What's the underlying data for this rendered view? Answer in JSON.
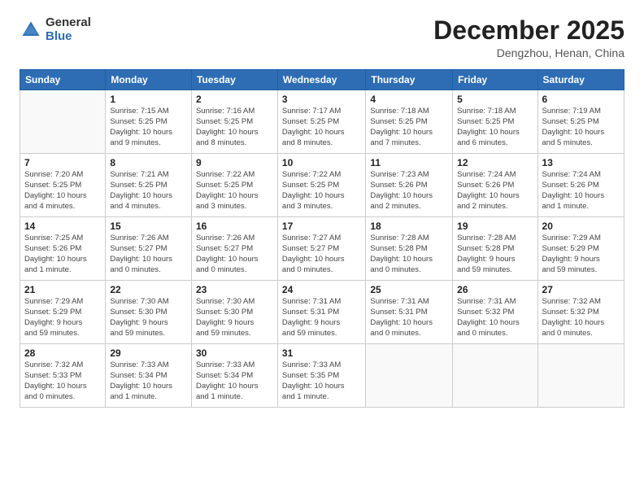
{
  "logo": {
    "general": "General",
    "blue": "Blue"
  },
  "header": {
    "month": "December 2025",
    "location": "Dengzhou, Henan, China"
  },
  "weekdays": [
    "Sunday",
    "Monday",
    "Tuesday",
    "Wednesday",
    "Thursday",
    "Friday",
    "Saturday"
  ],
  "weeks": [
    [
      {
        "day": "",
        "info": ""
      },
      {
        "day": "1",
        "info": "Sunrise: 7:15 AM\nSunset: 5:25 PM\nDaylight: 10 hours\nand 9 minutes."
      },
      {
        "day": "2",
        "info": "Sunrise: 7:16 AM\nSunset: 5:25 PM\nDaylight: 10 hours\nand 8 minutes."
      },
      {
        "day": "3",
        "info": "Sunrise: 7:17 AM\nSunset: 5:25 PM\nDaylight: 10 hours\nand 8 minutes."
      },
      {
        "day": "4",
        "info": "Sunrise: 7:18 AM\nSunset: 5:25 PM\nDaylight: 10 hours\nand 7 minutes."
      },
      {
        "day": "5",
        "info": "Sunrise: 7:18 AM\nSunset: 5:25 PM\nDaylight: 10 hours\nand 6 minutes."
      },
      {
        "day": "6",
        "info": "Sunrise: 7:19 AM\nSunset: 5:25 PM\nDaylight: 10 hours\nand 5 minutes."
      }
    ],
    [
      {
        "day": "7",
        "info": "Sunrise: 7:20 AM\nSunset: 5:25 PM\nDaylight: 10 hours\nand 4 minutes."
      },
      {
        "day": "8",
        "info": "Sunrise: 7:21 AM\nSunset: 5:25 PM\nDaylight: 10 hours\nand 4 minutes."
      },
      {
        "day": "9",
        "info": "Sunrise: 7:22 AM\nSunset: 5:25 PM\nDaylight: 10 hours\nand 3 minutes."
      },
      {
        "day": "10",
        "info": "Sunrise: 7:22 AM\nSunset: 5:25 PM\nDaylight: 10 hours\nand 3 minutes."
      },
      {
        "day": "11",
        "info": "Sunrise: 7:23 AM\nSunset: 5:26 PM\nDaylight: 10 hours\nand 2 minutes."
      },
      {
        "day": "12",
        "info": "Sunrise: 7:24 AM\nSunset: 5:26 PM\nDaylight: 10 hours\nand 2 minutes."
      },
      {
        "day": "13",
        "info": "Sunrise: 7:24 AM\nSunset: 5:26 PM\nDaylight: 10 hours\nand 1 minute."
      }
    ],
    [
      {
        "day": "14",
        "info": "Sunrise: 7:25 AM\nSunset: 5:26 PM\nDaylight: 10 hours\nand 1 minute."
      },
      {
        "day": "15",
        "info": "Sunrise: 7:26 AM\nSunset: 5:27 PM\nDaylight: 10 hours\nand 0 minutes."
      },
      {
        "day": "16",
        "info": "Sunrise: 7:26 AM\nSunset: 5:27 PM\nDaylight: 10 hours\nand 0 minutes."
      },
      {
        "day": "17",
        "info": "Sunrise: 7:27 AM\nSunset: 5:27 PM\nDaylight: 10 hours\nand 0 minutes."
      },
      {
        "day": "18",
        "info": "Sunrise: 7:28 AM\nSunset: 5:28 PM\nDaylight: 10 hours\nand 0 minutes."
      },
      {
        "day": "19",
        "info": "Sunrise: 7:28 AM\nSunset: 5:28 PM\nDaylight: 9 hours\nand 59 minutes."
      },
      {
        "day": "20",
        "info": "Sunrise: 7:29 AM\nSunset: 5:29 PM\nDaylight: 9 hours\nand 59 minutes."
      }
    ],
    [
      {
        "day": "21",
        "info": "Sunrise: 7:29 AM\nSunset: 5:29 PM\nDaylight: 9 hours\nand 59 minutes."
      },
      {
        "day": "22",
        "info": "Sunrise: 7:30 AM\nSunset: 5:30 PM\nDaylight: 9 hours\nand 59 minutes."
      },
      {
        "day": "23",
        "info": "Sunrise: 7:30 AM\nSunset: 5:30 PM\nDaylight: 9 hours\nand 59 minutes."
      },
      {
        "day": "24",
        "info": "Sunrise: 7:31 AM\nSunset: 5:31 PM\nDaylight: 9 hours\nand 59 minutes."
      },
      {
        "day": "25",
        "info": "Sunrise: 7:31 AM\nSunset: 5:31 PM\nDaylight: 10 hours\nand 0 minutes."
      },
      {
        "day": "26",
        "info": "Sunrise: 7:31 AM\nSunset: 5:32 PM\nDaylight: 10 hours\nand 0 minutes."
      },
      {
        "day": "27",
        "info": "Sunrise: 7:32 AM\nSunset: 5:32 PM\nDaylight: 10 hours\nand 0 minutes."
      }
    ],
    [
      {
        "day": "28",
        "info": "Sunrise: 7:32 AM\nSunset: 5:33 PM\nDaylight: 10 hours\nand 0 minutes."
      },
      {
        "day": "29",
        "info": "Sunrise: 7:33 AM\nSunset: 5:34 PM\nDaylight: 10 hours\nand 1 minute."
      },
      {
        "day": "30",
        "info": "Sunrise: 7:33 AM\nSunset: 5:34 PM\nDaylight: 10 hours\nand 1 minute."
      },
      {
        "day": "31",
        "info": "Sunrise: 7:33 AM\nSunset: 5:35 PM\nDaylight: 10 hours\nand 1 minute."
      },
      {
        "day": "",
        "info": ""
      },
      {
        "day": "",
        "info": ""
      },
      {
        "day": "",
        "info": ""
      }
    ]
  ]
}
